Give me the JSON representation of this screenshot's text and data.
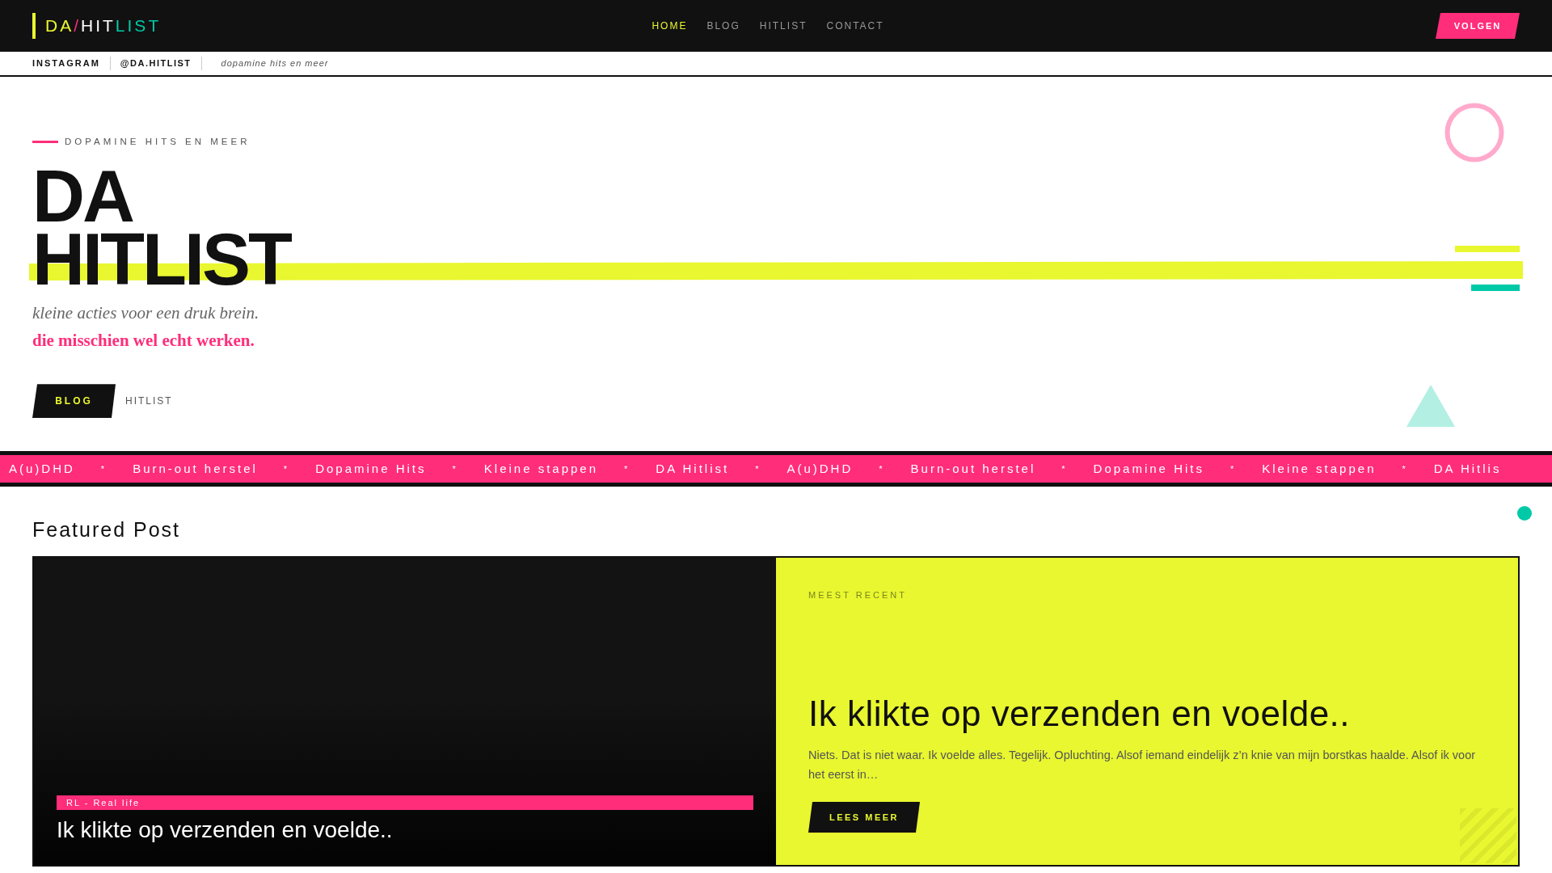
{
  "logo": [
    {
      "text": "DA",
      "color": "#e8f72f"
    },
    {
      "text": "/",
      "color": "#ff2d7a"
    },
    {
      "text": "HIT",
      "color": "#ffffff"
    },
    {
      "text": "LIST",
      "color": "#00c9a7"
    }
  ],
  "nav": [
    {
      "label": "HOME",
      "selected": true
    },
    {
      "label": "BLOG",
      "selected": false
    },
    {
      "label": "HITLIST",
      "selected": false
    },
    {
      "label": "CONTACT",
      "selected": false
    }
  ],
  "follow_button": "VOLGEN",
  "subbar": {
    "network": "INSTAGRAM",
    "handle": "@DA.HITLIST",
    "tagline": "dopamine hits en meer"
  },
  "hero": {
    "eyebrow": "DOPAMINE HITS EN MEER",
    "title_lines": [
      "DA",
      "HITLIST"
    ],
    "subtitle": "kleine acties voor een druk brein.",
    "accent": "die misschien wel echt werken.",
    "primary_button": "BLOG",
    "secondary_link": "HITLIST"
  },
  "ticker": [
    {
      "kind": "item",
      "text": "A(u)DHD"
    },
    {
      "kind": "separator",
      "text": "*"
    },
    {
      "kind": "item",
      "text": "Burn-out herstel"
    },
    {
      "kind": "separator",
      "text": "*"
    },
    {
      "kind": "item",
      "text": "Dopamine Hits"
    },
    {
      "kind": "separator",
      "text": "*"
    },
    {
      "kind": "item",
      "text": "Kleine stappen"
    },
    {
      "kind": "separator",
      "text": "*"
    },
    {
      "kind": "item",
      "text": "DA Hitlist"
    },
    {
      "kind": "separator",
      "text": "*"
    },
    {
      "kind": "item",
      "text": "A(u)DHD"
    },
    {
      "kind": "separator",
      "text": "*"
    },
    {
      "kind": "item",
      "text": "Burn-out herstel"
    },
    {
      "kind": "separator",
      "text": "*"
    },
    {
      "kind": "item",
      "text": "Dopamine Hits"
    },
    {
      "kind": "separator",
      "text": "*"
    },
    {
      "kind": "item",
      "text": "Kleine stappen"
    },
    {
      "kind": "separator",
      "text": "*"
    },
    {
      "kind": "item",
      "text": "DA Hitlis"
    }
  ],
  "featured": {
    "heading": "Featured Post",
    "tag": "RL - Real life",
    "image_title": "Ik klikte op verzenden en voelde..",
    "label": "MEEST RECENT",
    "title": "Ik klikte op verzenden en voelde..",
    "excerpt": "Niets. Dat is niet waar. Ik voelde alles. Tegelijk. Opluchting. Alsof iemand eindelijk z’n knie van mijn borstkas haalde. Alsof ik voor het eerst in…",
    "button": "LEES MEER"
  }
}
